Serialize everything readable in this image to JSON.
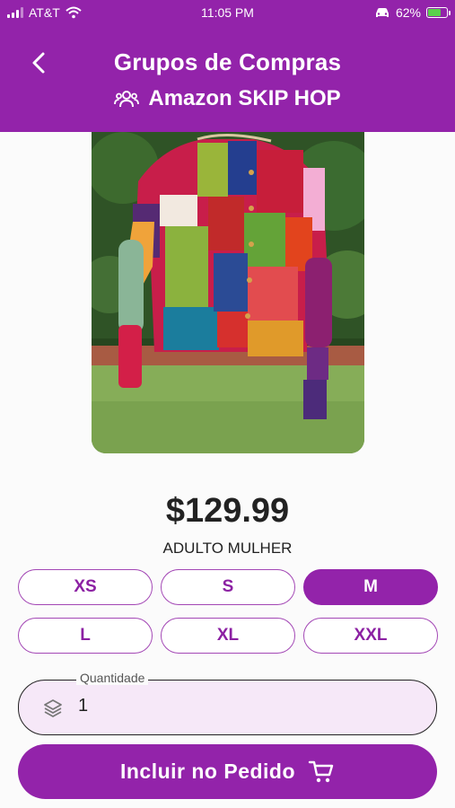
{
  "status_bar": {
    "carrier": "AT&T",
    "time": "11:05 PM",
    "battery": "62%",
    "battery_level": 0.62
  },
  "header": {
    "title": "Grupos de Compras",
    "group_name": "Amazon SKIP HOP"
  },
  "product": {
    "price": "$129.99",
    "category": "ADULTO MULHER"
  },
  "sizes": [
    {
      "label": "XS",
      "selected": false
    },
    {
      "label": "S",
      "selected": false
    },
    {
      "label": "M",
      "selected": true
    },
    {
      "label": "L",
      "selected": false
    },
    {
      "label": "XL",
      "selected": false
    },
    {
      "label": "XXL",
      "selected": false
    }
  ],
  "quantity": {
    "label": "Quantidade",
    "value": "1"
  },
  "submit": {
    "label": "Incluir no Pedido"
  },
  "colors": {
    "primary": "#9323aa",
    "field_bg": "#f6e8f8"
  }
}
